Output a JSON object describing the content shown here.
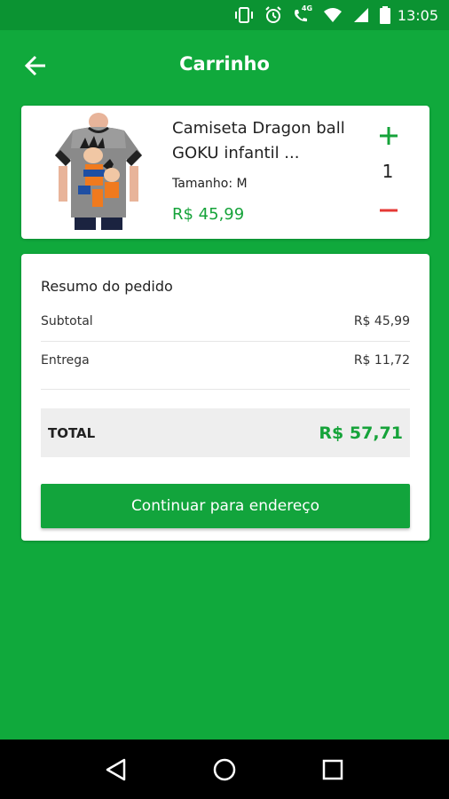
{
  "status_bar": {
    "time": "13:05",
    "network_label": "4G",
    "icons": [
      "vibrate-icon",
      "alarm-icon",
      "call-4g-icon",
      "wifi-icon",
      "signal-icon",
      "battery-icon"
    ]
  },
  "app_bar": {
    "title": "Carrinho",
    "back_icon": "arrow-left-icon"
  },
  "cart_item": {
    "name_line1": "Camiseta Dragon ball",
    "name_line2": "GOKU infantil ...",
    "size": "Tamanho: M",
    "price": "R$ 45,99",
    "quantity": "1",
    "image": "tshirt-product-image"
  },
  "summary": {
    "title": "Resumo do pedido",
    "subtotal_label": "Subtotal",
    "subtotal_value": "R$ 45,99",
    "delivery_label": "Entrega",
    "delivery_value": "R$ 11,72",
    "total_label": "TOTAL",
    "total_value": "R$ 57,71"
  },
  "continue_button": "Continuar para endereço",
  "colors": {
    "primary": "#10a93c",
    "status_bar": "#0b9332",
    "price_green": "#16a33a",
    "minus_red": "#e53935"
  }
}
